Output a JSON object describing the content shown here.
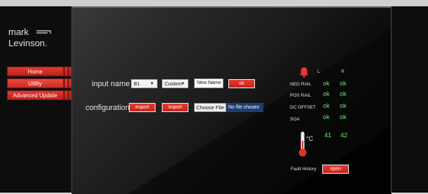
{
  "logo": {
    "line1": "mark",
    "line2": "Levinson."
  },
  "nav": {
    "home": "Home",
    "utility": "Utility",
    "advanced_update": "Advanced Update"
  },
  "input_name": {
    "label": "input name",
    "input_select_value": "B1",
    "mode_select_value": "Custom",
    "new_name_value": "New Name",
    "ok_label": "ok"
  },
  "configuration": {
    "label": "configuration",
    "export_label": "export",
    "import_label": "import",
    "choose_file_label": "Choose File",
    "file_status": "No file chosen"
  },
  "status": {
    "col_left": "L",
    "col_right": "R",
    "rows": [
      {
        "label": "NEG RAIL",
        "left": "ok",
        "right": "ok"
      },
      {
        "label": "POS RAIL",
        "left": "ok",
        "right": "ok"
      },
      {
        "label": "DC OFFSET",
        "left": "ok",
        "right": "ok"
      },
      {
        "label": "SOA",
        "left": "ok",
        "right": "ok"
      }
    ],
    "temp_unit": "°C",
    "temp_left": "41",
    "temp_right": "42",
    "fault_history_label": "Fault History",
    "open_label": "open"
  },
  "colors": {
    "accent_red": "#d52c24",
    "ok_green": "#6de56d",
    "file_status_bg": "#1e3d74"
  },
  "icons": [
    "alarm-bell-icon",
    "thermometer-icon",
    "dropdown-arrow-icon"
  ]
}
